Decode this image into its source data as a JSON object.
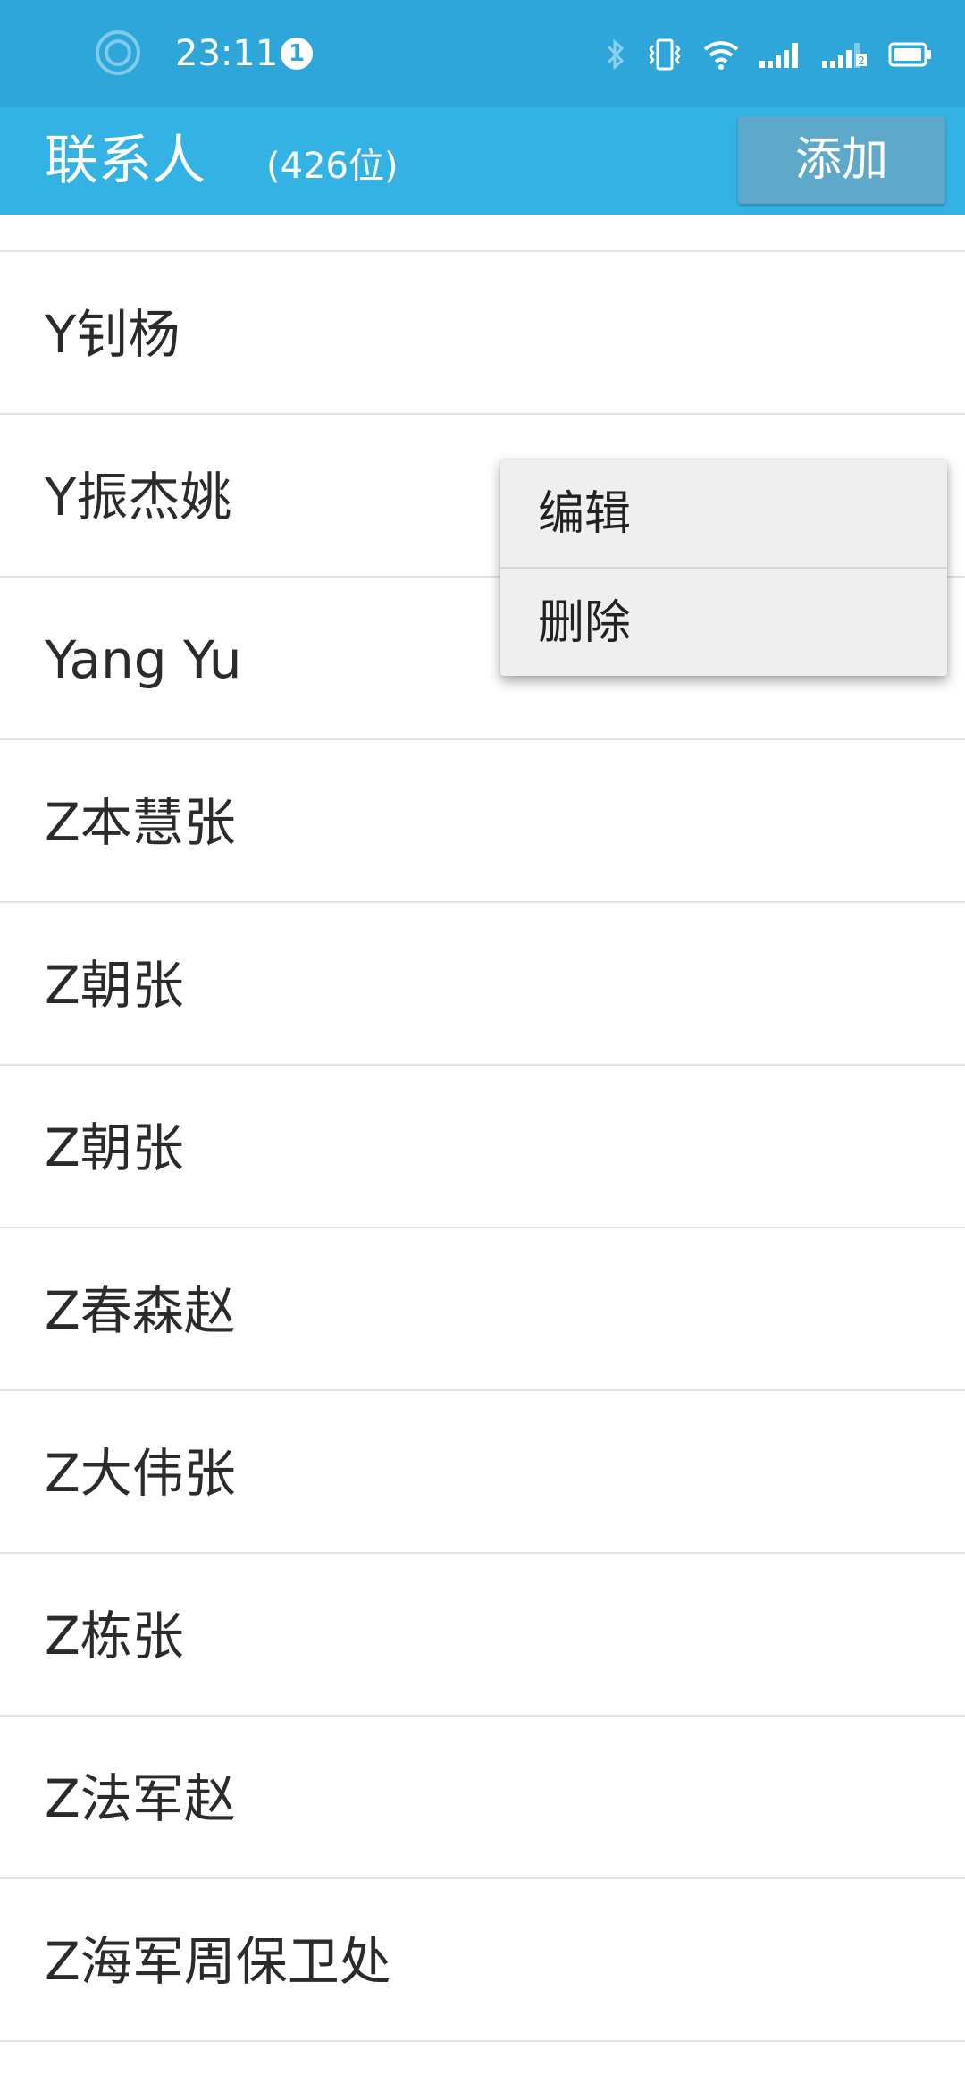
{
  "status_bar": {
    "time": "23:11",
    "notification_count": "1",
    "background": "#2fa6d9",
    "icons": [
      "target-ring-icon",
      "bluetooth-icon",
      "vibrate-icon",
      "wifi-icon",
      "signal-icon",
      "signal-2-icon",
      "battery-icon"
    ]
  },
  "app_bar": {
    "title": "联系人",
    "count": "(426位)",
    "add_label": "添加",
    "background": "#34b2e4"
  },
  "contacts": [
    {
      "name": "Y钊杨"
    },
    {
      "name": "Y振杰姚"
    },
    {
      "name": "Yang Yu"
    },
    {
      "name": "Z本慧张"
    },
    {
      "name": "Z朝张"
    },
    {
      "name": "Z朝张"
    },
    {
      "name": "Z春森赵"
    },
    {
      "name": "Z大伟张"
    },
    {
      "name": "Z栋张"
    },
    {
      "name": "Z法军赵"
    },
    {
      "name": "Z海军周保卫处"
    }
  ],
  "context_menu": {
    "items": [
      {
        "label": "编辑"
      },
      {
        "label": "删除"
      }
    ]
  }
}
